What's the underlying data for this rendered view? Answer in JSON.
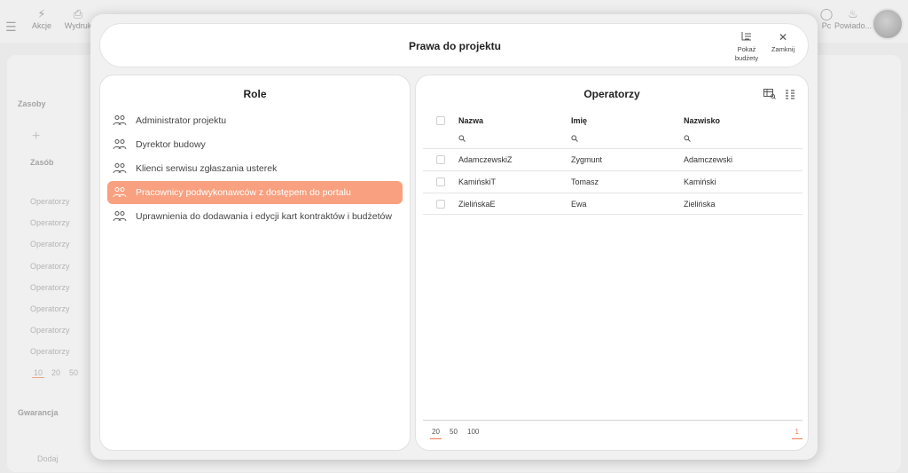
{
  "background": {
    "toolbar": {
      "items": [
        {
          "label": "Akcje",
          "icon": "lightning-icon"
        },
        {
          "label": "Wydruk",
          "icon": "printer-icon"
        },
        {
          "label": "Pc",
          "icon": "generic-icon"
        },
        {
          "label": "Powiado...",
          "icon": "bell-icon"
        }
      ]
    },
    "sections": {
      "resources": "Zasoby",
      "resource_column": "Zasób",
      "guarantee": "Gwarancja",
      "add_label": "Dodaj"
    },
    "rows": [
      "Operatorzy",
      "Operatorzy",
      "Operatorzy",
      "Operatorzy",
      "Operatorzy",
      "Operatorzy",
      "Operatorzy",
      "Operatorzy"
    ],
    "page_sizes": [
      "10",
      "20",
      "50"
    ]
  },
  "modal": {
    "title": "Prawa do projektu",
    "buttons": {
      "show_budgets_line1": "Pokaż",
      "show_budgets_line2": "budżety",
      "close": "Zamknij"
    }
  },
  "roles_panel": {
    "title": "Role",
    "items": [
      {
        "label": "Administrator projektu",
        "selected": false
      },
      {
        "label": "Dyrektor budowy",
        "selected": false
      },
      {
        "label": "Klienci serwisu zgłaszania usterek",
        "selected": false
      },
      {
        "label": "Pracownicy podwykonawców z dostępem do portalu",
        "selected": true
      },
      {
        "label": "Uprawnienia do dodawania i edycji kart kontraktów i budżetów",
        "selected": false
      }
    ]
  },
  "operators_panel": {
    "title": "Operatorzy",
    "columns": [
      "Nazwa",
      "Imię",
      "Nazwisko"
    ],
    "rows": [
      {
        "login": "AdamczewskiZ",
        "first_name": "Zygmunt",
        "last_name": "Adamczewski"
      },
      {
        "login": "KamińskiT",
        "first_name": "Tomasz",
        "last_name": "Kamiński"
      },
      {
        "login": "ZielińskaE",
        "first_name": "Ewa",
        "last_name": "Zielińska"
      }
    ],
    "page_sizes": [
      "20",
      "50",
      "100"
    ],
    "active_page_size": "20",
    "current_page": "1"
  },
  "colors": {
    "accent": "#f8a07f",
    "accent_dark": "#f07a4e"
  }
}
